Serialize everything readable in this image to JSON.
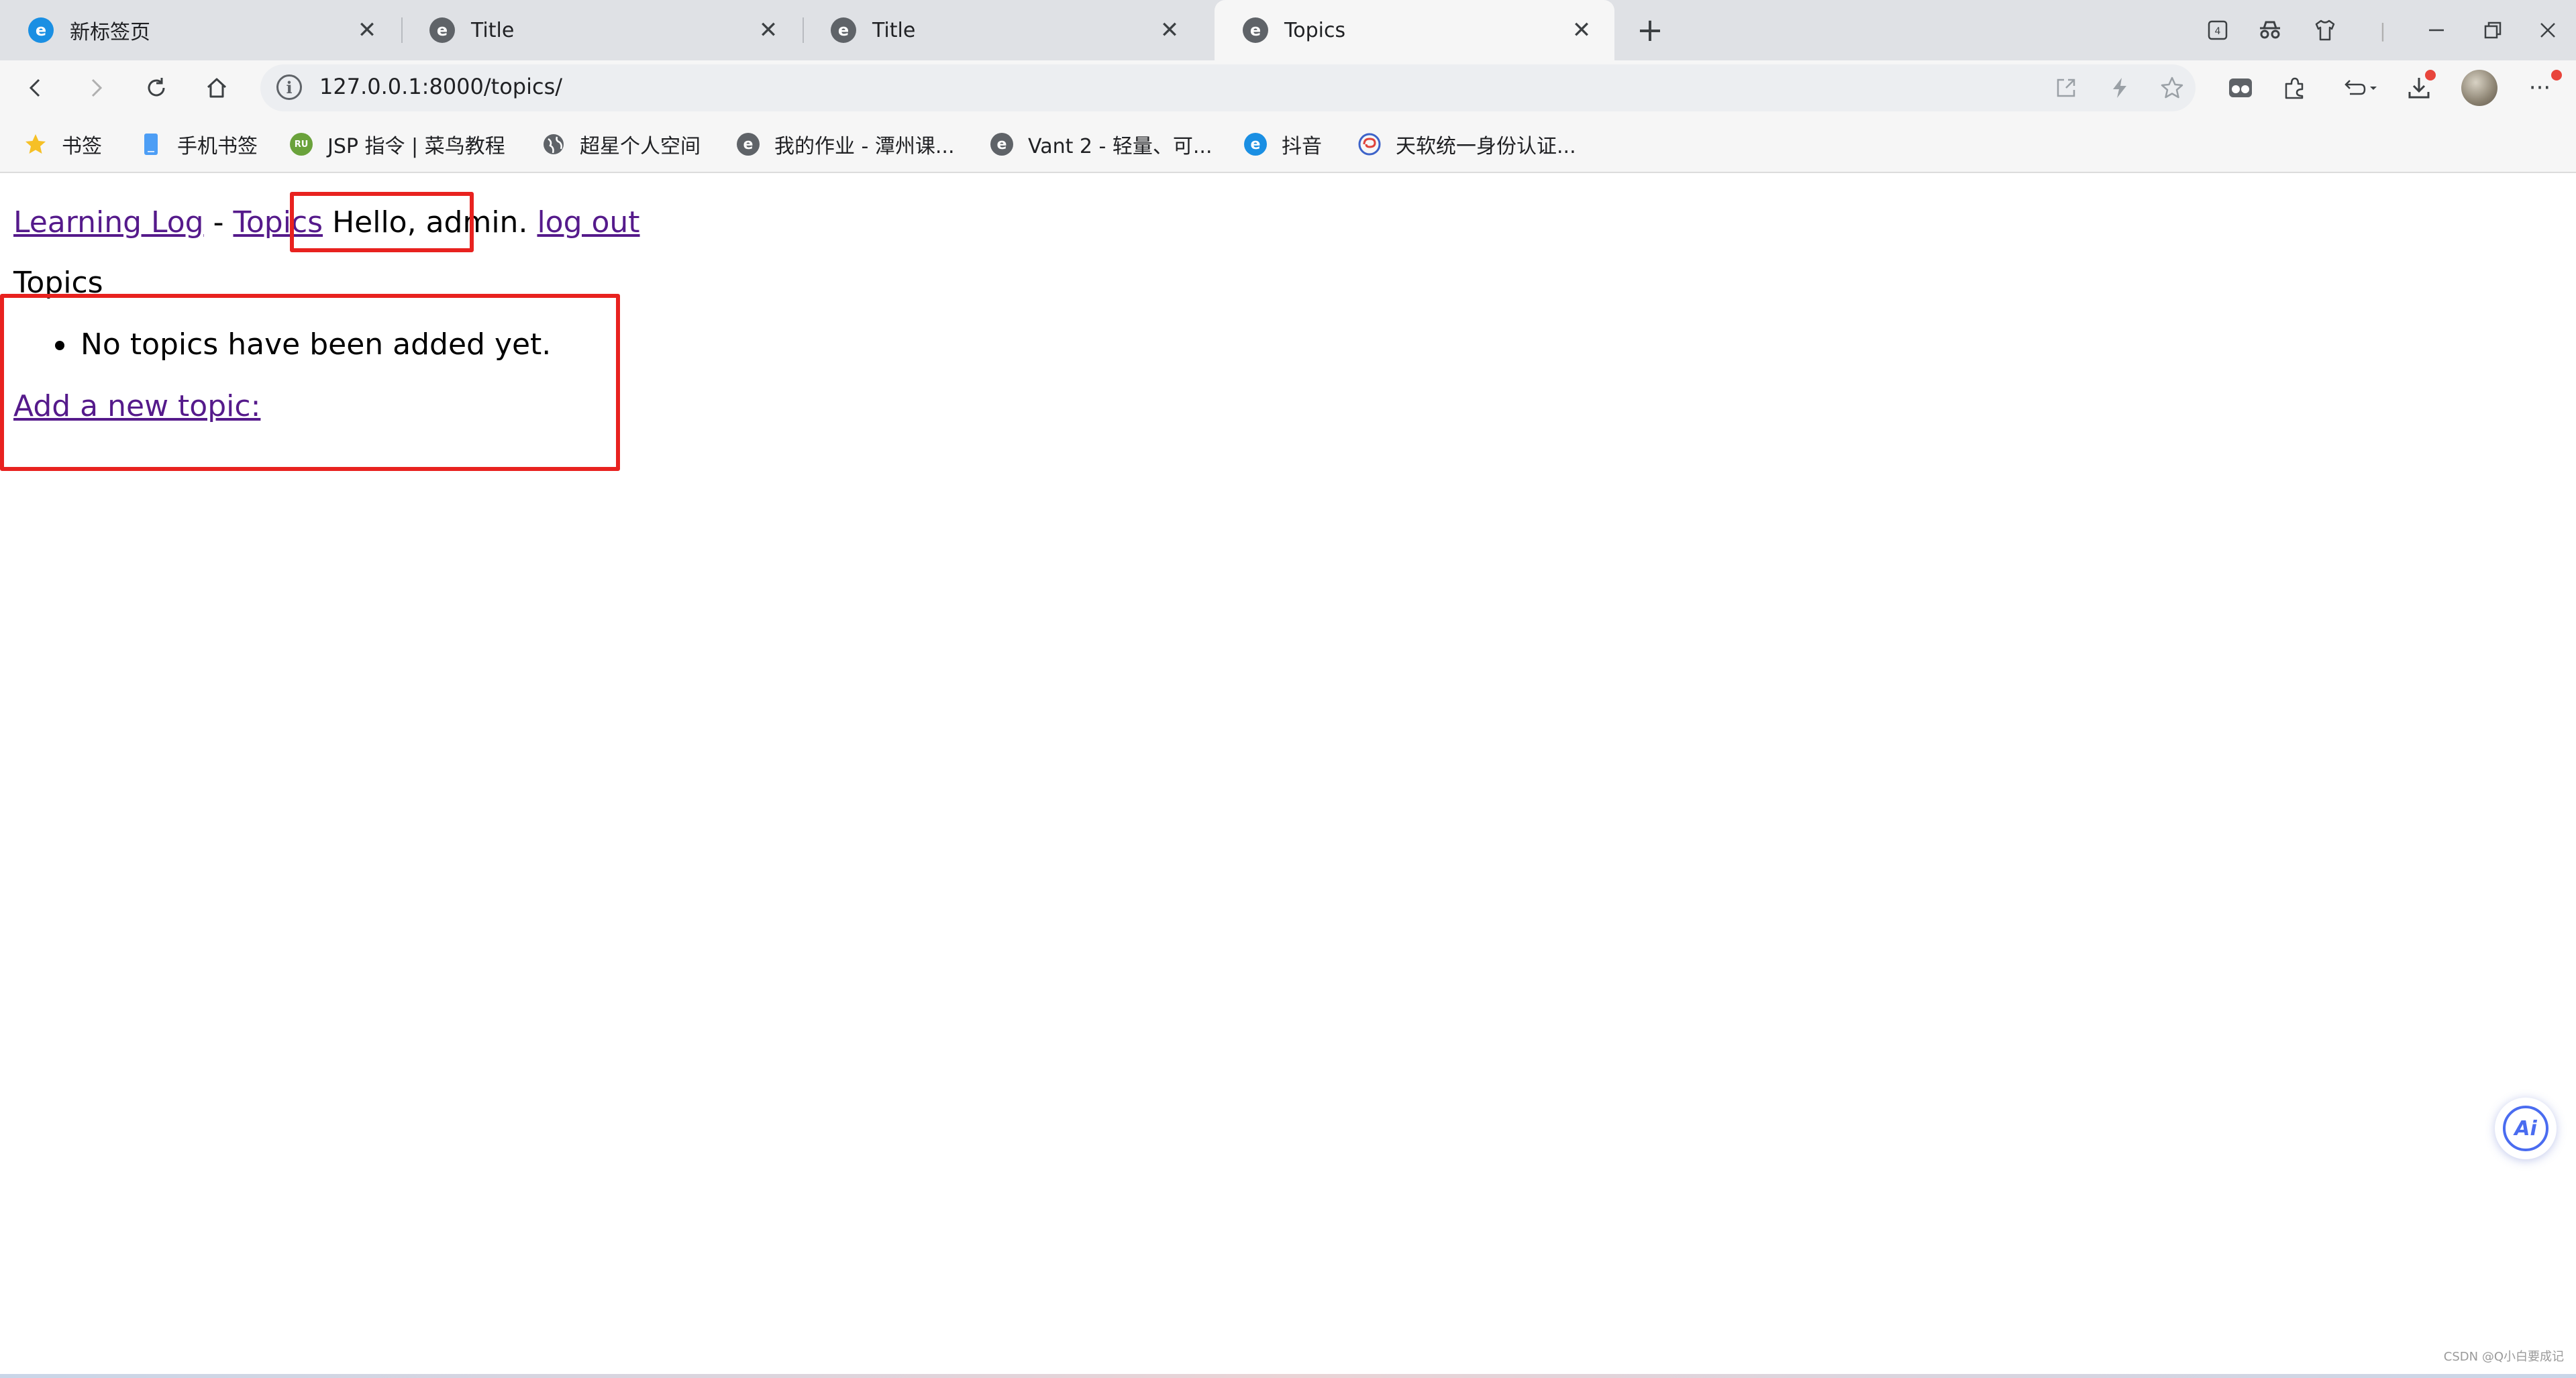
{
  "tabs": [
    {
      "title": "新标签页",
      "icon": "edge-icon",
      "active": false
    },
    {
      "title": "Title",
      "icon": "edge-icon",
      "active": false
    },
    {
      "title": "Title",
      "icon": "edge-icon",
      "active": false
    },
    {
      "title": "Topics",
      "icon": "edge-icon",
      "active": true
    }
  ],
  "toolbar": {
    "url": "127.0.0.1:8000/topics/"
  },
  "bookmarks": [
    {
      "label": "书签",
      "icon": "star-icon"
    },
    {
      "label": "手机书签",
      "icon": "phone-icon"
    },
    {
      "label": "JSP 指令 | 菜鸟教程",
      "icon": "runoob-icon"
    },
    {
      "label": "超星个人空间",
      "icon": "globe-icon"
    },
    {
      "label": "我的作业 - 潭州课...",
      "icon": "edge-icon"
    },
    {
      "label": "Vant 2 - 轻量、可...",
      "icon": "edge-icon"
    },
    {
      "label": "抖音",
      "icon": "edge-icon"
    },
    {
      "label": "天软统一身份认证...",
      "icon": "swirl-icon"
    }
  ],
  "page": {
    "site_link": "Learning Log",
    "separator": "-",
    "topics_link": "Topics",
    "greeting": "Hello, admin.",
    "logout_link": "log out",
    "heading": "Topics",
    "empty_message": "No topics have been added yet.",
    "add_link": "Add a new topic:"
  },
  "ai_button": {
    "label": "Ai"
  },
  "watermark": "CSDN @Q小白要成记",
  "colors": {
    "annotation_red": "#e8221f",
    "visited_link": "#551a8b",
    "accent_blue": "#4a6cf0"
  }
}
